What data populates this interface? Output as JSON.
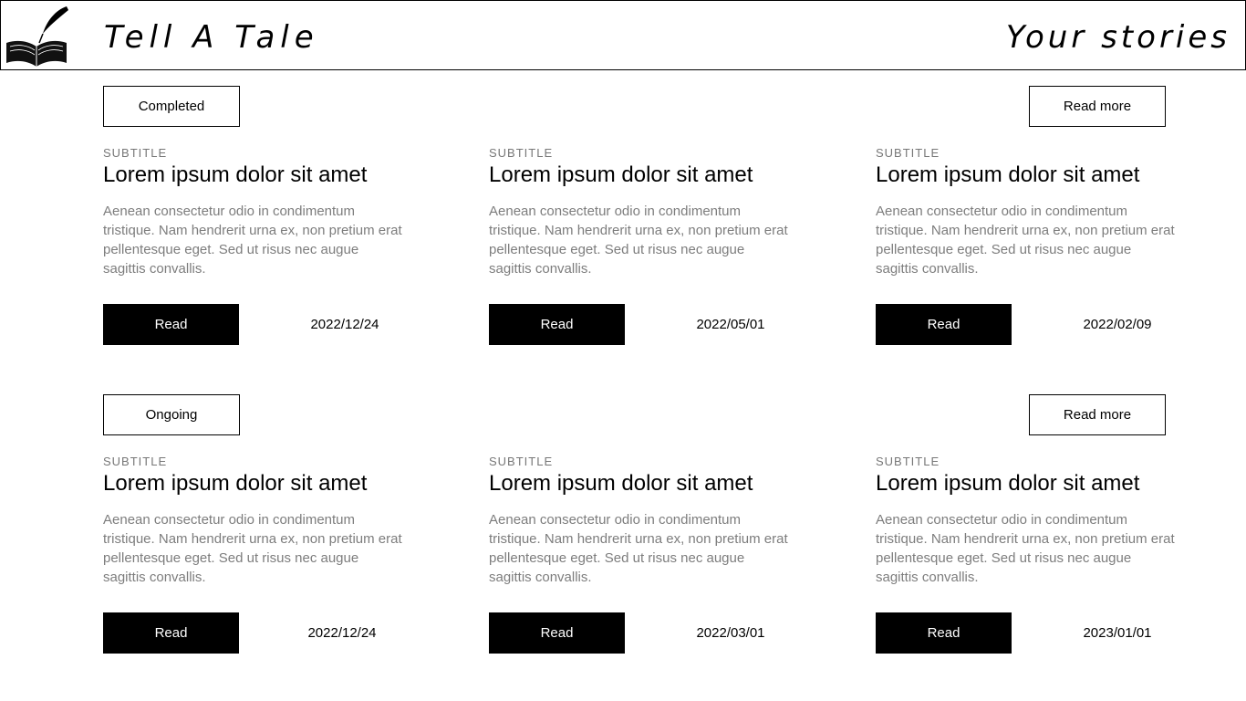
{
  "header": {
    "logo_text": "Tell A Tale",
    "title": "Tell A Tale",
    "nav_link": "Your stories"
  },
  "sections": [
    {
      "status_label": "Completed",
      "read_more_label": "Read more",
      "cards": [
        {
          "subtitle": "SUBTITLE",
          "title": "Lorem ipsum dolor sit amet",
          "description": "Aenean consectetur odio in condimentum tristique. Nam hendrerit urna ex, non pretium erat pellentesque eget. Sed ut risus nec augue sagittis convallis.",
          "read_label": "Read",
          "date": "2022/12/24"
        },
        {
          "subtitle": "SUBTITLE",
          "title": "Lorem ipsum dolor sit amet",
          "description": "Aenean consectetur odio in condimentum tristique. Nam hendrerit urna ex, non pretium erat pellentesque eget. Sed ut risus nec augue sagittis convallis.",
          "read_label": "Read",
          "date": "2022/05/01"
        },
        {
          "subtitle": "SUBTITLE",
          "title": "Lorem ipsum dolor sit amet",
          "description": "Aenean consectetur odio in condimentum tristique. Nam hendrerit urna ex, non pretium erat pellentesque eget. Sed ut risus nec augue sagittis convallis.",
          "read_label": "Read",
          "date": "2022/02/09"
        }
      ]
    },
    {
      "status_label": "Ongoing",
      "read_more_label": "Read more",
      "cards": [
        {
          "subtitle": "SUBTITLE",
          "title": "Lorem ipsum dolor sit amet",
          "description": "Aenean consectetur odio in condimentum tristique. Nam hendrerit urna ex, non pretium erat pellentesque eget. Sed ut risus nec augue sagittis convallis.",
          "read_label": "Read",
          "date": "2022/12/24"
        },
        {
          "subtitle": "SUBTITLE",
          "title": "Lorem ipsum dolor sit amet",
          "description": "Aenean consectetur odio in condimentum tristique. Nam hendrerit urna ex, non pretium erat pellentesque eget. Sed ut risus nec augue sagittis convallis.",
          "read_label": "Read",
          "date": "2022/03/01"
        },
        {
          "subtitle": "SUBTITLE",
          "title": "Lorem ipsum dolor sit amet",
          "description": "Aenean consectetur odio in condimentum tristique. Nam hendrerit urna ex, non pretium erat pellentesque eget. Sed ut risus nec augue sagittis convallis.",
          "read_label": "Read",
          "date": "2023/01/01"
        }
      ]
    }
  ]
}
